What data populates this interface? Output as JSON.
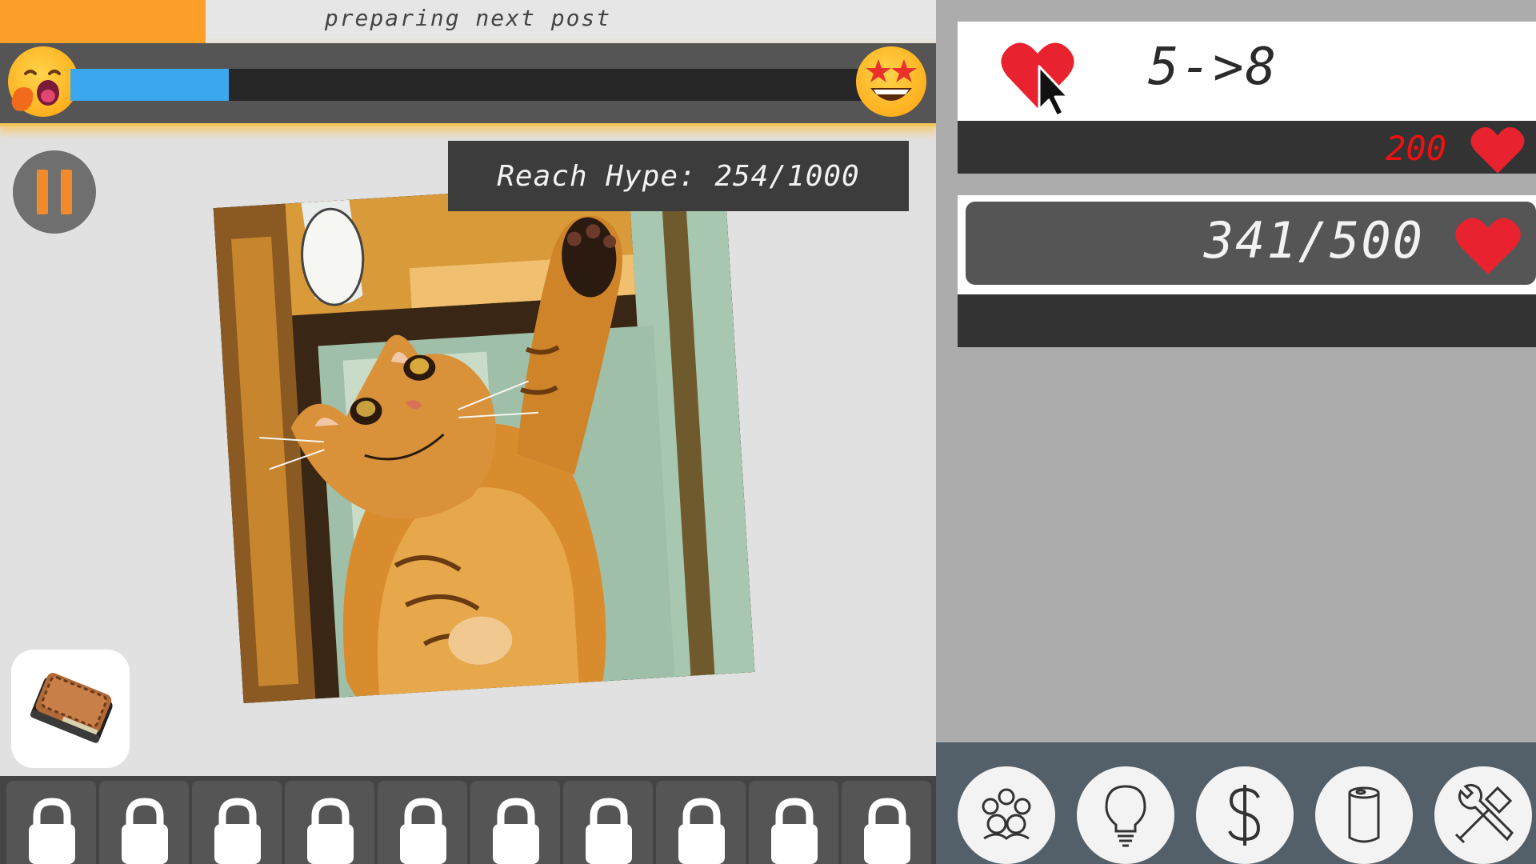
{
  "post_progress": {
    "label": "preparing next post",
    "fraction": 0.22,
    "color": "#fd9f2a"
  },
  "mood_meter": {
    "fraction": 0.2,
    "fill_color": "#3ba7ef",
    "left_icon": "yawning-face-icon",
    "right_icon": "star-struck-face-icon"
  },
  "hype": {
    "label": "Reach Hype: 254/1000",
    "current": 254,
    "target": 1000
  },
  "post": {
    "image": "cat-photo"
  },
  "click_upgrade": {
    "value": "5->8",
    "cost": "200",
    "icon": "heart-cursor-icon",
    "cost_icon": "heart-icon",
    "heart_color": "#e8222e"
  },
  "likes": {
    "value": "341/500",
    "current": 341,
    "max": 500,
    "icon": "heart-icon"
  },
  "lock_slots": 10,
  "bottom_menu": [
    {
      "name": "followers-button",
      "icon": "group-icon"
    },
    {
      "name": "ideas-button",
      "icon": "lightbulb-icon"
    },
    {
      "name": "money-button",
      "icon": "dollar-icon"
    },
    {
      "name": "storage-button",
      "icon": "cylinder-icon"
    },
    {
      "name": "tools-button",
      "icon": "tools-icon"
    }
  ],
  "wallet": {
    "icon": "wallet-icon"
  }
}
